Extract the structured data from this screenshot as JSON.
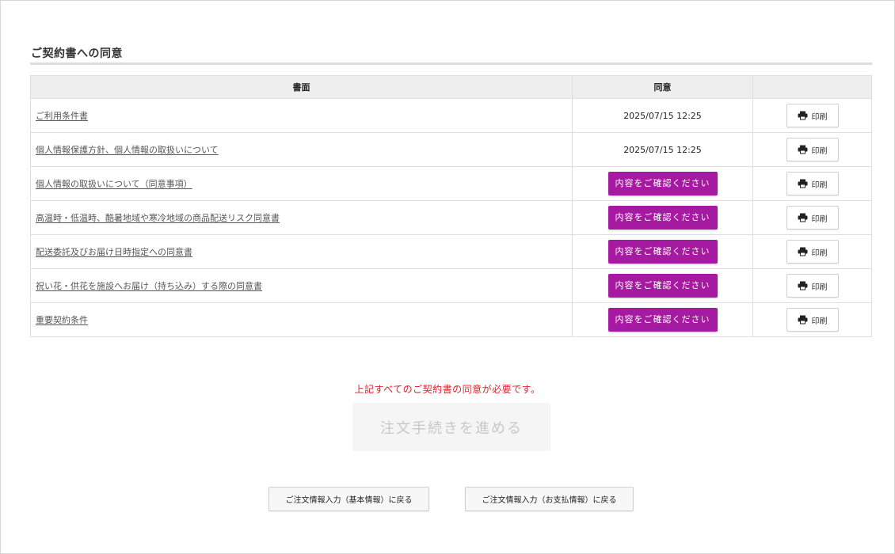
{
  "section": {
    "title": "ご契約書への同意"
  },
  "table": {
    "headers": {
      "document": "書面",
      "agreement": "同意",
      "print": ""
    },
    "rows": [
      {
        "document": "ご利用条件書",
        "agreed": true,
        "agreement": "2025/07/15 12:25",
        "print_label": "印刷"
      },
      {
        "document": "個人情報保護方針、個人情報の取扱いについて",
        "agreed": true,
        "agreement": "2025/07/15 12:25",
        "print_label": "印刷"
      },
      {
        "document": "個人情報の取扱いについて（同意事項）",
        "agreed": false,
        "agreement": "内容をご確認ください",
        "print_label": "印刷"
      },
      {
        "document": "高温時・低温時、酷暑地域や寒冷地域の商品配送リスク同意書",
        "agreed": false,
        "agreement": "内容をご確認ください",
        "print_label": "印刷"
      },
      {
        "document": "配送委託及びお届け日時指定への同意書",
        "agreed": false,
        "agreement": "内容をご確認ください",
        "print_label": "印刷"
      },
      {
        "document": "祝い花・供花を施設へお届け（持ち込み）する際の同意書",
        "agreed": false,
        "agreement": "内容をご確認ください",
        "print_label": "印刷"
      },
      {
        "document": "重要契約条件",
        "agreed": false,
        "agreement": "内容をご確認ください",
        "print_label": "印刷"
      }
    ]
  },
  "notice": "上記すべてのご契約書の同意が必要です。",
  "proceed_button": {
    "label": "注文手続きを進める",
    "enabled": false
  },
  "back_buttons": {
    "basic": "ご注文情報入力（基本情報）に戻る",
    "payment": "ご注文情報入力（お支払情報）に戻る"
  },
  "colors": {
    "confirm_button": "#a51aa0",
    "notice_text": "#e0202a",
    "header_bg": "#eeeeee"
  },
  "icons": {
    "print": "printer-icon"
  }
}
